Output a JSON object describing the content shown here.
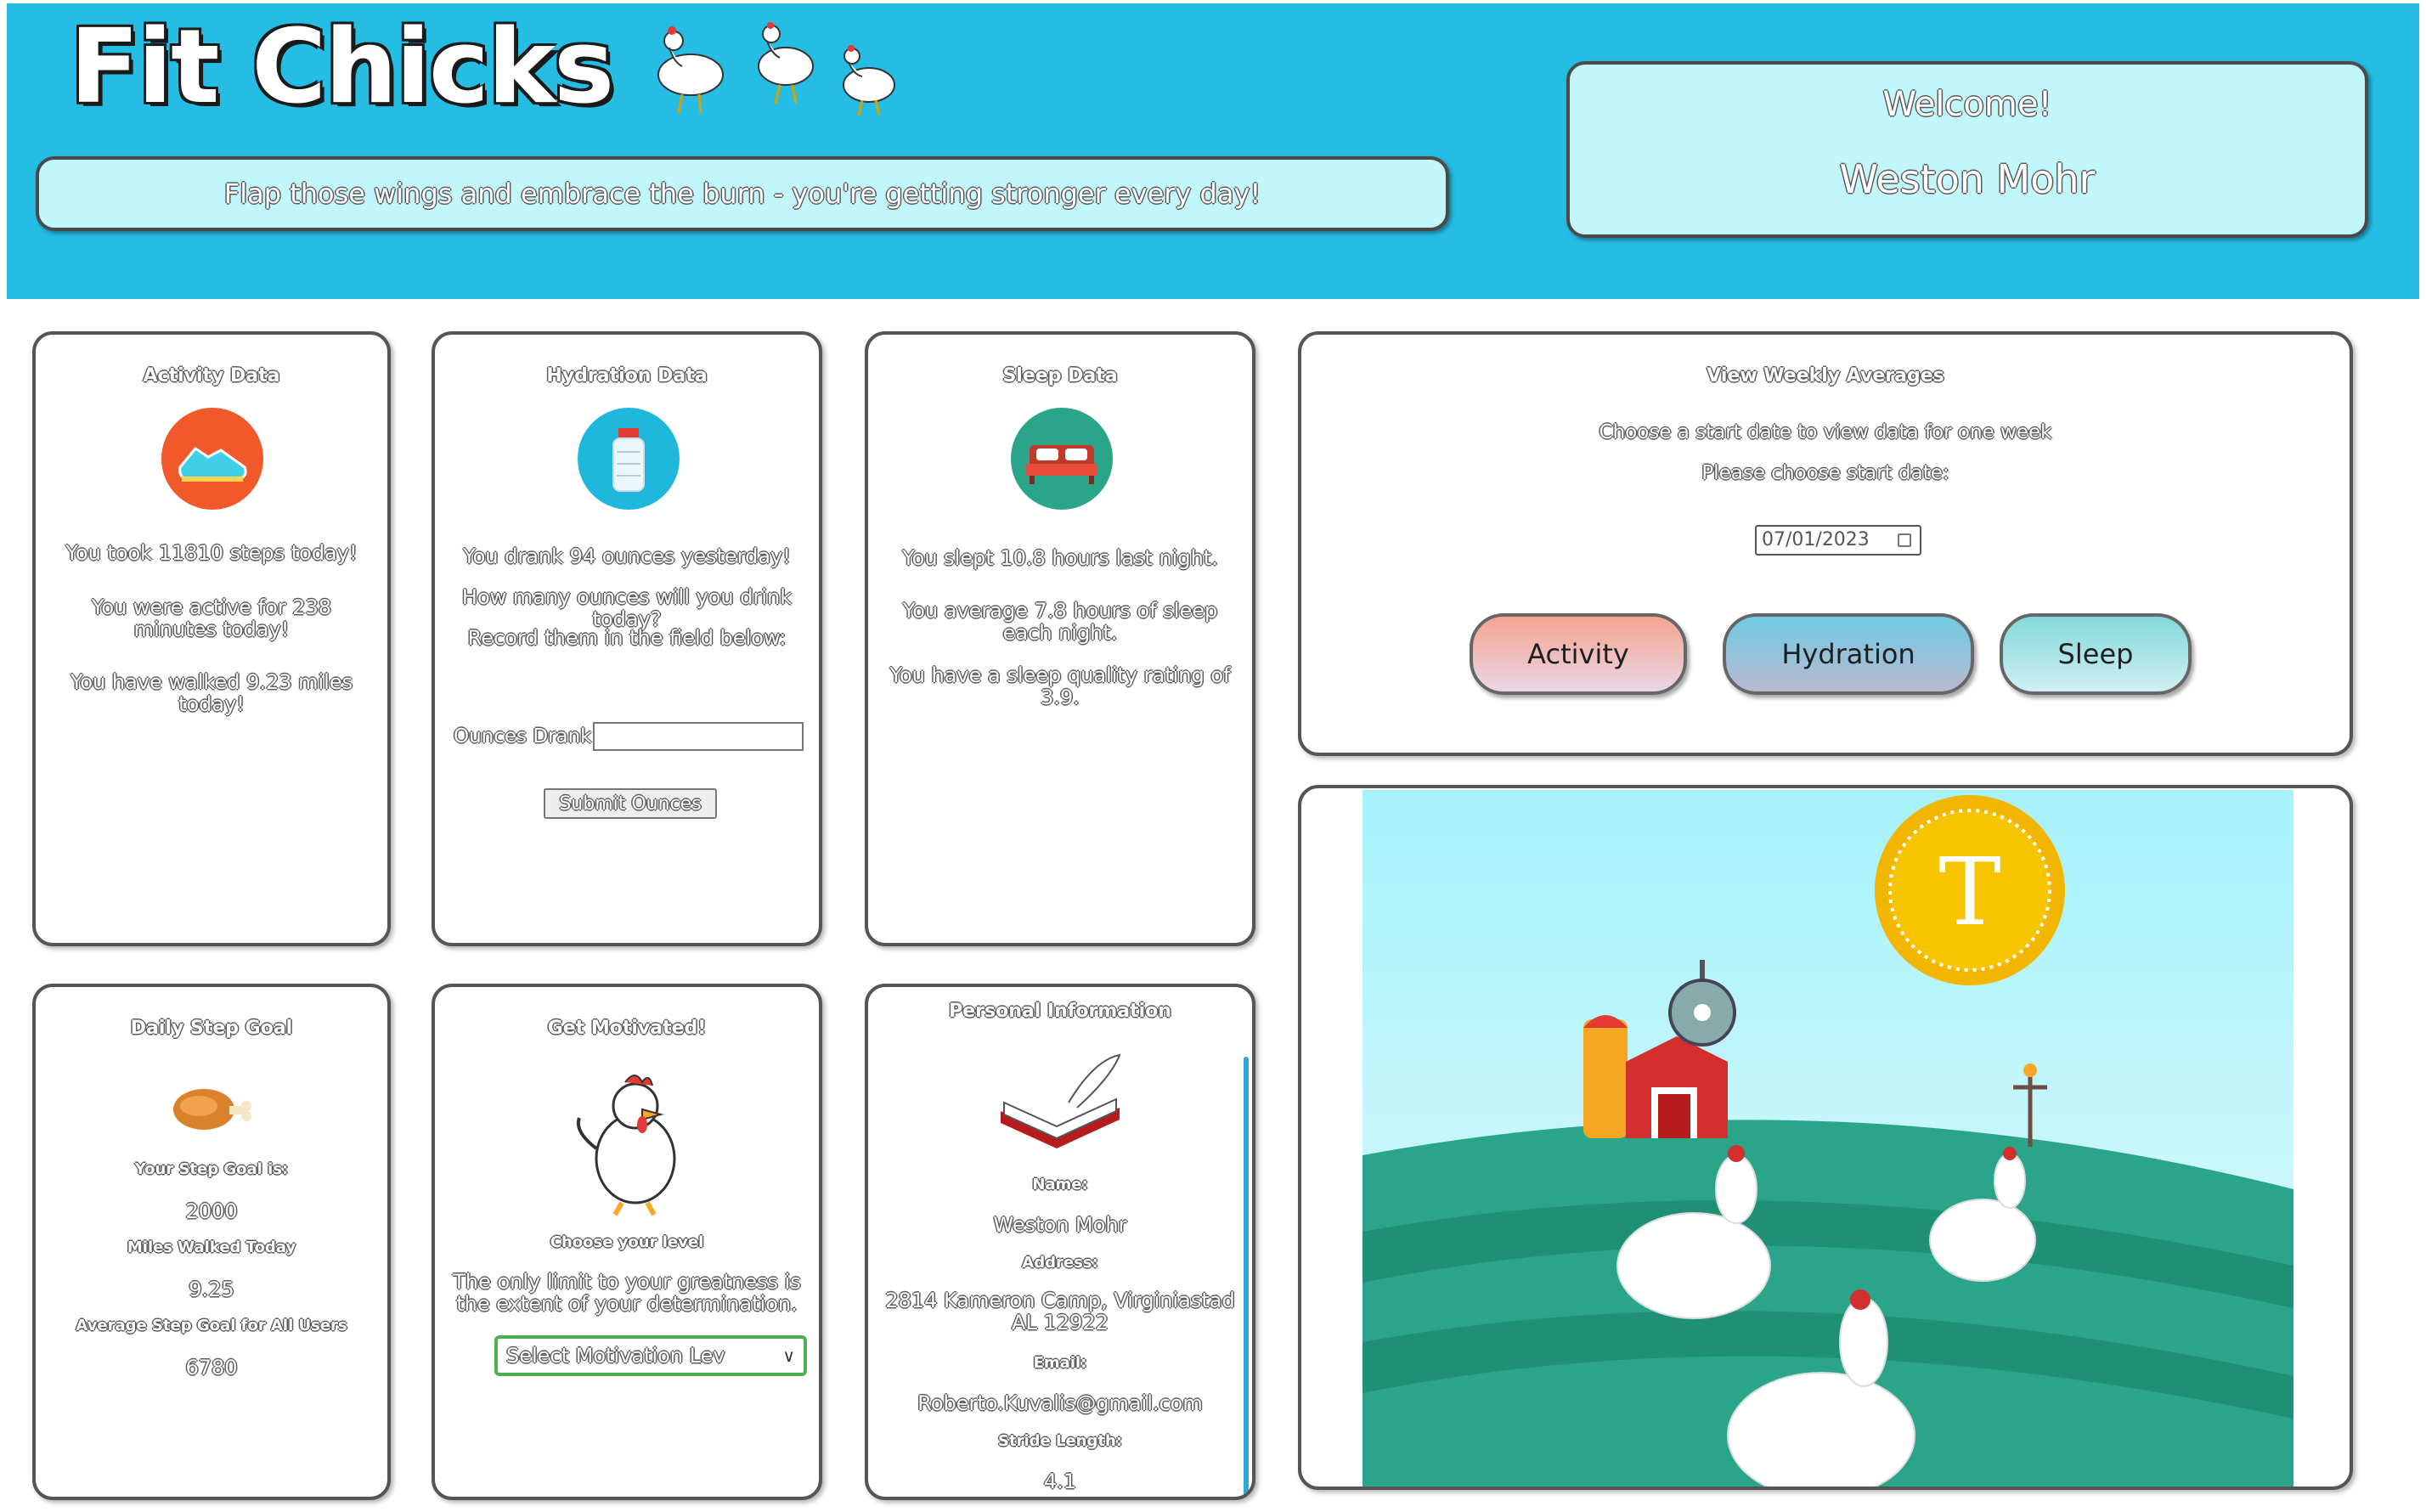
{
  "header": {
    "logo_text": "Fit Chicks",
    "motto": "Flap those wings and embrace the burn - you're getting stronger every day!",
    "welcome_label": "Welcome!",
    "user_name": "Weston Mohr"
  },
  "activity_card": {
    "title": "Activity Data",
    "icon": "running-shoe-icon",
    "steps_text": "You took 11810 steps today!",
    "active_text": "You were active for 238 minutes today!",
    "miles_text": "You have walked 9.23 miles today!"
  },
  "hydration_card": {
    "title": "Hydration Data",
    "icon": "water-bottle-icon",
    "line1": "You drank 94 ounces yesterday!",
    "line2": "How many ounces will you drink today?",
    "line3": "Record them in the field below:",
    "input_label": "Ounces Drank",
    "input_value": "",
    "submit_label": "Submit Ounces"
  },
  "sleep_card": {
    "title": "Sleep Data",
    "icon": "bed-icon",
    "line1": "You slept 10.8 hours last night.",
    "line2": "You average 7.8 hours of sleep each night.",
    "line3": "You have a sleep quality rating of 3.9."
  },
  "weekly_card": {
    "title": "View Weekly Averages",
    "subtitle": "Choose a start date to view data for one week",
    "prompt": "Please choose start date:",
    "date_value": "07/01/2023",
    "buttons": {
      "activity": "Activity",
      "hydration": "Hydration",
      "sleep": "Sleep"
    },
    "colors": {
      "activity": "#f5a48f",
      "hydration": "#6fcbe3",
      "sleep": "#83d9da"
    }
  },
  "step_goal_card": {
    "title": "Daily Step Goal",
    "icon": "drumstick-icon",
    "goal_label": "Your Step Goal is:",
    "goal_value": "2000",
    "miles_label": "Miles Walked Today",
    "miles_value": "9.25",
    "avg_label": "Average Step Goal for All Users",
    "avg_value": "6780"
  },
  "motivation_card": {
    "title": "Get Motivated!",
    "icon": "rooster-icon",
    "choose_label": "Choose your level",
    "quote": "The only limit to your greatness is the extent of your determination.",
    "select_value": "Select Motivation Lev"
  },
  "personal_card": {
    "title": "Personal Information",
    "icon": "book-quill-icon",
    "name_label": "Name:",
    "name_value": "Weston Mohr",
    "address_label": "Address:",
    "address_value": "2814 Kameron Camp, Virginiastad AL 12922",
    "email_label": "Email:",
    "email_value": "Roberto.Kuvalis@gmail.com",
    "stride_label": "Stride Length:",
    "stride_value": "4.1"
  },
  "farm_scene": {
    "badge_letter": "T"
  },
  "colors": {
    "header_bg": "#25bde4",
    "panel_bg": "#c1f6fb",
    "select_border": "#4caf50",
    "scrollbar": "#2ea7d6"
  }
}
